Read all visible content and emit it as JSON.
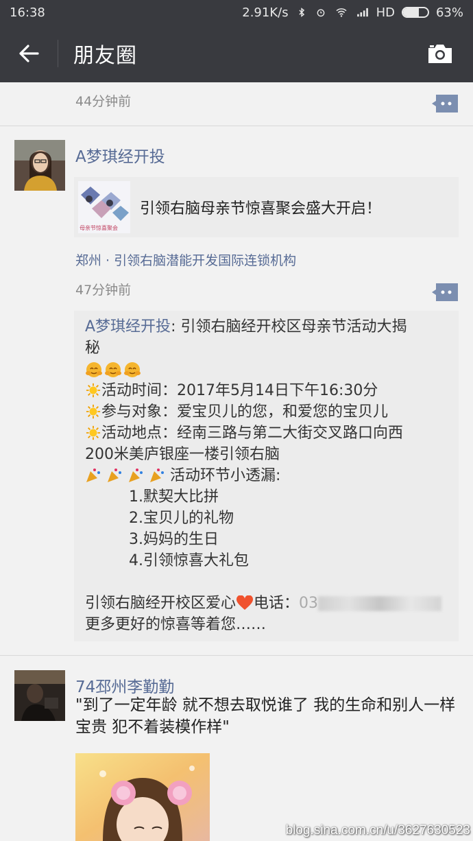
{
  "status_bar": {
    "time": "16:38",
    "speed": "2.91K/s",
    "network": "HD",
    "battery": "63%",
    "battery_level": 0.63
  },
  "header": {
    "back_icon": "back-arrow-icon",
    "title": "朋友圈",
    "camera_icon": "camera-icon"
  },
  "feed": {
    "prev_post": {
      "time": "44分钟前"
    },
    "post1": {
      "username": "A梦琪经开投",
      "link_card": {
        "title": "引领右脑母亲节惊喜聚会盛大开启！",
        "thumb_caption": "母亲节惊喜聚会"
      },
      "location": "郑州 · 引领右脑潜能开发国际连锁机构",
      "time": "47分钟前",
      "comment": {
        "author": "A梦琪经开投",
        "sep": ": ",
        "line1": "引领右脑经开校区母亲节活动大揭",
        "line2": "秘",
        "time_line": "活动时间：2017年5月14日下午16:30分",
        "target_line": "参与对象：爱宝贝儿的您，和爱您的宝贝儿",
        "place_line1": "活动地点：经南三路与第二大街交叉路口向西",
        "place_line2": "200米美庐银座一楼引领右脑",
        "highlights_title": "活动环节小透漏:",
        "items": [
          "1.默契大比拼",
          "2.宝贝儿的礼物",
          "3.妈妈的生日",
          "4.引领惊喜大礼包"
        ],
        "phone_prefix": "引领右脑经开校区爱心",
        "phone_label": "电话：",
        "phone_partial": "03",
        "closing": "更多更好的惊喜等着您……"
      }
    },
    "post2": {
      "username": "74邳州李勤勤",
      "text": "\"到了一定年龄 就不想去取悦谁了 我的生命和别人一样宝贵 犯不着装模作样\""
    }
  },
  "watermark": "blog.sina.com.cn/u/3627630523"
}
